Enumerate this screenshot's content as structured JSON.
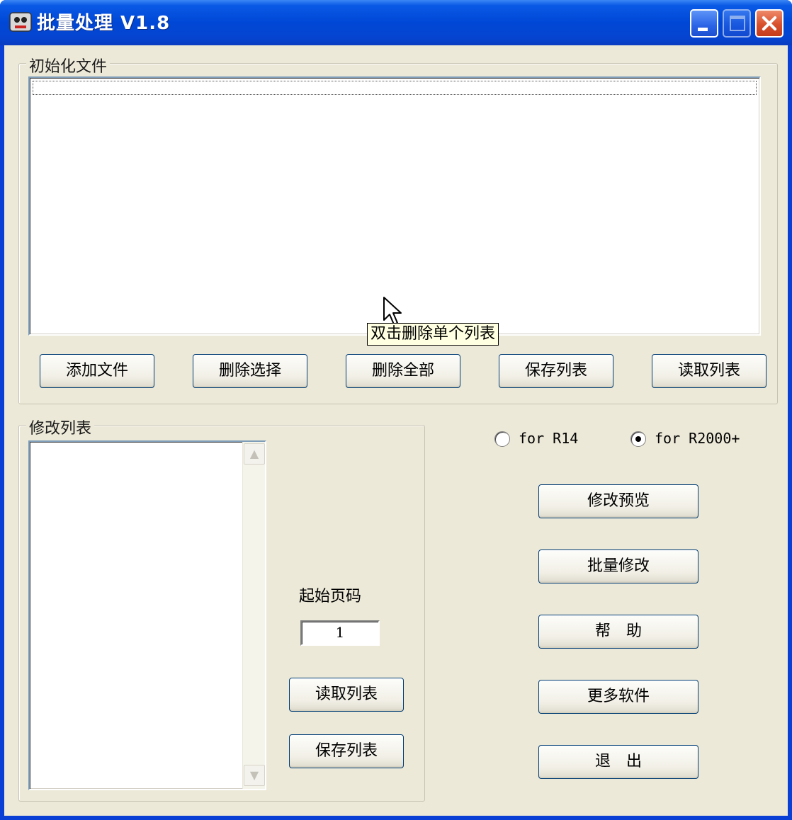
{
  "window": {
    "title": "批量处理 V1.8"
  },
  "init_group": {
    "label": "初始化文件",
    "buttons": {
      "add_file": "添加文件",
      "delete_selected": "删除选择",
      "delete_all": "删除全部",
      "save_list": "保存列表",
      "read_list": "读取列表"
    },
    "tooltip": "双击删除单个列表"
  },
  "modify_group": {
    "label": "修改列表",
    "start_page_label": "起始页码",
    "start_page_value": "1",
    "buttons": {
      "read_list": "读取列表",
      "save_list": "保存列表"
    }
  },
  "options": {
    "radio_r14": {
      "label": "for R14",
      "selected": false
    },
    "radio_r2000": {
      "label": "for R2000+",
      "selected": true
    }
  },
  "actions": {
    "preview": "修改预览",
    "batch_modify": "批量修改",
    "help": "帮　助",
    "more_software": "更多软件",
    "exit": "退　出"
  }
}
